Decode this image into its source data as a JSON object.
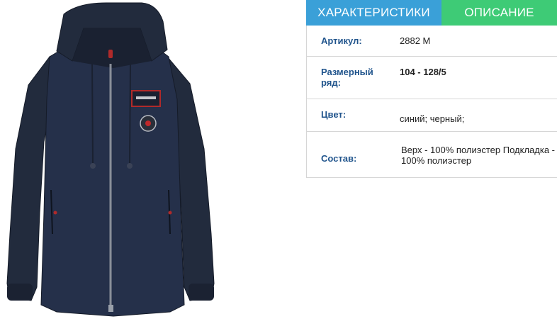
{
  "tabs": [
    {
      "label": "ХАРАКТЕРИСТИКИ",
      "active": true
    },
    {
      "label": "ОПИСАНИЕ",
      "active": false
    }
  ],
  "specs": [
    {
      "label": "Артикул:",
      "value": "2882 М"
    },
    {
      "label": "Размерный ряд:",
      "value": "104 - 128/5"
    },
    {
      "label": "Цвет:",
      "value": "синий; черный;"
    },
    {
      "label": "Состав:",
      "value": "Верх - 100% полиэстер Подкладка - 100% полиэстер"
    }
  ],
  "colors": {
    "tab_characteristics": "#3aa0d8",
    "tab_description": "#3ecb76",
    "label": "#20548c",
    "jacket": "#222b3d"
  },
  "product_image": "navy-hooded-jacket-photo"
}
